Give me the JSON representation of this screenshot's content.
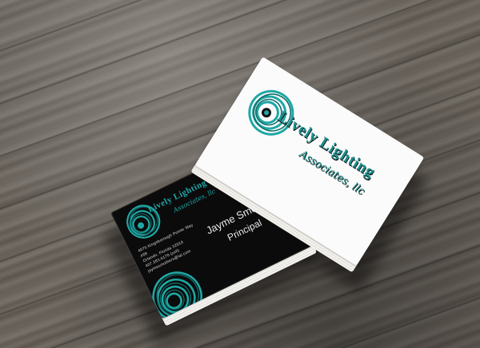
{
  "company": {
    "logo_lead": "L",
    "logo_name": "ively Lighting",
    "logo_sub": "Associates, llc"
  },
  "person": {
    "name": "Jayme Smothers",
    "title": "Principal"
  },
  "contact": {
    "lines": [
      "4076 Kingsborough Pointe Way",
      "#89",
      "Orlando, Florida 32810",
      "407.383.6178 (cell)",
      "jaymesmothers@lal.com"
    ]
  },
  "colors": {
    "accent": "#1fa7a4",
    "accent_dark": "#0f6f6d",
    "card_black": "#0b0b0c",
    "card_white": "#fbfbfb"
  }
}
